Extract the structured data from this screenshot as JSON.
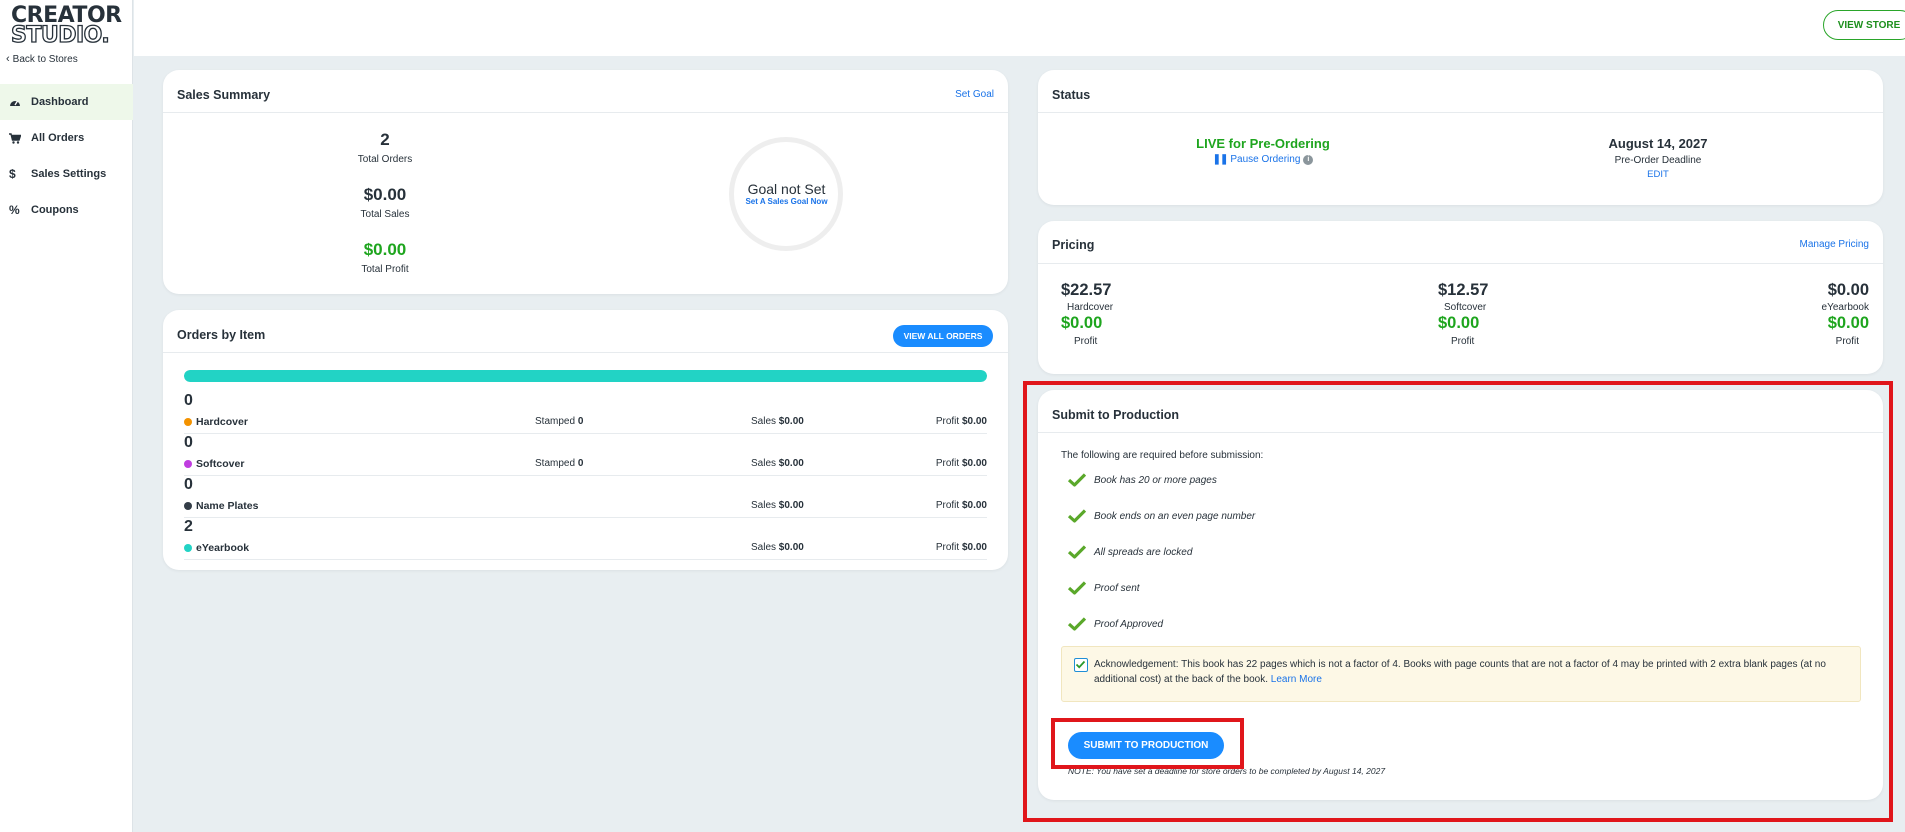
{
  "brand": {
    "line1": "CREATOR",
    "line2": "STUDIO."
  },
  "sidebar": {
    "back_label": "Back to Stores",
    "items": [
      {
        "label": "Dashboard",
        "icon": "dashboard-gauge-icon",
        "active": true
      },
      {
        "label": "All Orders",
        "icon": "cart-icon"
      },
      {
        "label": "Sales Settings",
        "icon": "dollar-icon"
      },
      {
        "label": "Coupons",
        "icon": "percent-icon"
      }
    ]
  },
  "header": {
    "view_store_label": "VIEW STORE",
    "avatar_icon": "user-avatar-icon"
  },
  "sales_summary": {
    "title": "Sales Summary",
    "set_goal_label": "Set Goal",
    "total_orders": {
      "value": "2",
      "label": "Total Orders"
    },
    "total_sales": {
      "value": "$0.00",
      "label": "Total Sales"
    },
    "total_profit": {
      "value": "$0.00",
      "label": "Total Profit"
    },
    "goal_text": "Goal not Set",
    "goal_link": "Set A Sales Goal Now"
  },
  "orders_by_item": {
    "title": "Orders by Item",
    "view_all_label": "VIEW ALL ORDERS",
    "progress_fill_fraction": 1.0,
    "progress_color": "#22d3c5",
    "stamped_label": "Stamped",
    "sales_label": "Sales",
    "profit_label": "Profit",
    "rows": [
      {
        "count": "0",
        "name": "Hardcover",
        "dot_color": "#f39200",
        "stamped": "0",
        "sales": "$0.00",
        "profit": "$0.00"
      },
      {
        "count": "0",
        "name": "Softcover",
        "dot_color": "#c03de0",
        "stamped": "0",
        "sales": "$0.00",
        "profit": "$0.00"
      },
      {
        "count": "0",
        "name": "Name Plates",
        "dot_color": "#333d47",
        "sales": "$0.00",
        "profit": "$0.00"
      },
      {
        "count": "2",
        "name": "eYearbook",
        "dot_color": "#22d3c5",
        "sales": "$0.00",
        "profit": "$0.00"
      }
    ]
  },
  "status": {
    "title": "Status",
    "live_text": "LIVE for Pre-Ordering",
    "pause_label": "Pause Ordering",
    "deadline_date": "August 14, 2027",
    "deadline_label": "Pre-Order Deadline",
    "edit_label": "EDIT"
  },
  "pricing": {
    "title": "Pricing",
    "manage_label": "Manage Pricing",
    "profit_label": "Profit",
    "items": [
      {
        "price": "$22.57",
        "name": "Hardcover",
        "profit": "$0.00"
      },
      {
        "price": "$12.57",
        "name": "Softcover",
        "profit": "$0.00"
      },
      {
        "price": "$0.00",
        "name": "eYearbook",
        "profit": "$0.00"
      }
    ]
  },
  "submit": {
    "title": "Submit to Production",
    "intro": "The following are required before submission:",
    "requirements": [
      "Book has 20 or more pages",
      "Book ends on an even page number",
      "All spreads are locked",
      "Proof sent",
      "Proof Approved"
    ],
    "ack_text": "Acknowledgement: This book has 22 pages which is not a factor of 4. Books with page counts that are not a factor of 4 may be printed with 2 extra blank pages (at no additional cost) at the back of the book.",
    "learn_more": "Learn More",
    "ack_checked": true,
    "button_label": "SUBMIT TO PRODUCTION",
    "note": "NOTE: You have set a deadline for store orders to be completed by August 14, 2027"
  },
  "colors": {
    "accent_blue": "#1a8cff",
    "green": "#1ea51e",
    "highlight_red": "#e0161b"
  }
}
